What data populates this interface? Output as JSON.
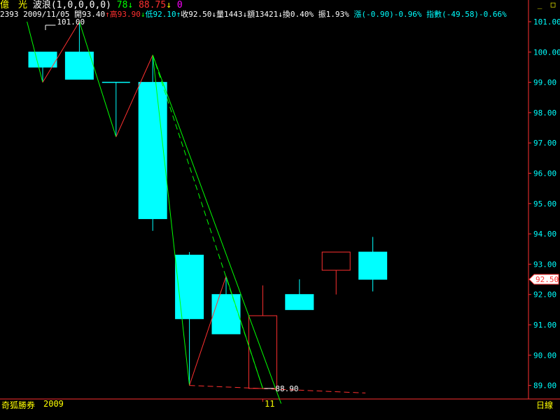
{
  "header": {
    "stock_name": "億　光",
    "indicator": "波浪(1,0,0,0,0)",
    "wave_up": "78",
    "wave_up_arrow": "↓",
    "wave_val": "88.75",
    "wave_down_arrow": "↓",
    "wave_zero": "0",
    "info_code": "2393",
    "info_date": "2009/11/05",
    "open_label": "開93.40",
    "high_label": "高93.90",
    "low_label": "低92.10",
    "close_label": "收92.50",
    "volume_label": "量1443",
    "amount_label": "額13421",
    "turnover_label": "換0.40%",
    "amplitude_label": "振1.93%",
    "change_label": "漲(-0.90)-0.96%",
    "index_label": "指數(-49.58)-0.66%",
    "up_arrow": "↑",
    "down_arrow": "↓"
  },
  "window_buttons": {
    "minimize": "_",
    "restore": "□"
  },
  "footer": {
    "broker": "奇狐勝券",
    "year": "2009",
    "month": "11",
    "period": "日線"
  },
  "colors": {
    "background": "#000000",
    "up_candle": "#ff3030",
    "down_candle": "#00ffff",
    "wave_up_line": "#ff3030",
    "wave_down_line": "#00ff00",
    "axis": "#ff3030",
    "tick_text": "#00ffff",
    "label_text": "#ffffff"
  },
  "chart_data": {
    "type": "candlestick",
    "y_ticks": [
      "101.00",
      "100.00",
      "99.00",
      "98.00",
      "97.00",
      "96.00",
      "95.00",
      "94.00",
      "93.00",
      "92.00",
      "91.00",
      "90.00",
      "89.00"
    ],
    "ylim": [
      88.6,
      101.5
    ],
    "current_price_label": "92.50",
    "current_price": 92.5,
    "high_annotation": "101.00",
    "low_annotation": "88.90",
    "candles": [
      {
        "open": 100.0,
        "close": 99.5,
        "high": 100.0,
        "low": 99.0
      },
      {
        "open": 100.0,
        "close": 99.1,
        "high": 101.0,
        "low": 99.1
      },
      {
        "open": 99.0,
        "close": 99.0,
        "high": 99.0,
        "low": 97.2
      },
      {
        "open": 99.0,
        "close": 94.5,
        "high": 99.9,
        "low": 94.1
      },
      {
        "open": 93.3,
        "close": 91.2,
        "high": 93.4,
        "low": 89.0
      },
      {
        "open": 92.0,
        "close": 90.7,
        "high": 92.6,
        "low": 90.7
      },
      {
        "open": 88.9,
        "close": 91.3,
        "high": 92.3,
        "low": 88.9
      },
      {
        "open": 92.0,
        "close": 91.5,
        "high": 92.5,
        "low": 91.5
      },
      {
        "open": 92.8,
        "close": 93.4,
        "high": 93.4,
        "low": 92.0
      },
      {
        "open": 93.4,
        "close": 92.5,
        "high": 93.9,
        "low": 92.1
      }
    ],
    "wave_points": [
      {
        "i": -1,
        "p": 101.0,
        "kind": "down"
      },
      {
        "i": 0,
        "p": 99.0,
        "kind": "up"
      },
      {
        "i": 1,
        "p": 101.0,
        "kind": "down"
      },
      {
        "i": 2,
        "p": 97.2,
        "kind": "up"
      },
      {
        "i": 3,
        "p": 99.9,
        "kind": "down"
      },
      {
        "i": 4,
        "p": 89.0,
        "kind": "up"
      },
      {
        "i": 5,
        "p": 92.6,
        "kind": "down"
      },
      {
        "i": 6,
        "p": 88.9,
        "kind": "end"
      }
    ],
    "extensions": [
      {
        "from_i": 3,
        "from_p": 99.9,
        "to_i": 6.5,
        "to_p": 88.4,
        "color": "green"
      },
      {
        "from_i": 3,
        "from_p": 99.9,
        "to_i": 6.0,
        "to_p": 88.9,
        "color": "green",
        "dashed": true
      },
      {
        "from_i": 4,
        "from_p": 89.0,
        "to_i": 8.8,
        "to_p": 88.75,
        "color": "red",
        "dashed": true
      }
    ]
  }
}
